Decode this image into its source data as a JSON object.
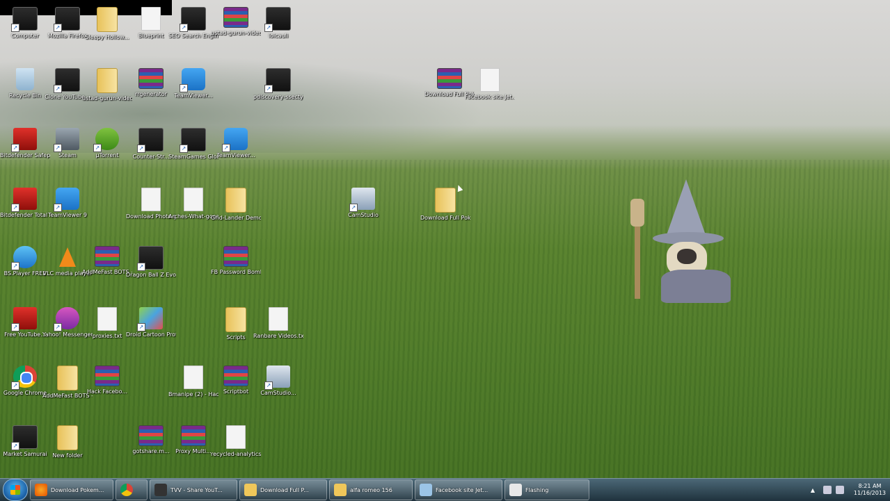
{
  "desktop_icons": [
    {
      "label": "Computer",
      "type": "app"
    },
    {
      "label": "Mozilla Firefox",
      "type": "app"
    },
    {
      "label": "Sleepy Hollow...",
      "type": "folder"
    },
    {
      "label": "Blueprint",
      "type": "doc"
    },
    {
      "label": "SEO Search Engine R...",
      "type": "app"
    },
    {
      "label": "ustad-gurun-video-sad...",
      "type": "rar"
    },
    {
      "label": "loicauli",
      "type": "app"
    },
    {
      "label": "Recycle Bin",
      "type": "bin"
    },
    {
      "label": "Clone YouTube...",
      "type": "app"
    },
    {
      "label": "ustad-gurun-video-sad...",
      "type": "folder"
    },
    {
      "label": "rrgenerator",
      "type": "rar"
    },
    {
      "label": "TeamViewer...",
      "type": "tv"
    },
    {
      "label": "pdlscovery-ssecty5.exe",
      "type": "app"
    },
    {
      "label": "Bitdefender Safepay",
      "type": "red"
    },
    {
      "label": "Steam",
      "type": "key"
    },
    {
      "label": "µTorrent",
      "type": "green"
    },
    {
      "label": "Counter-Str...",
      "type": "app"
    },
    {
      "label": "SteamGames Global Pla...",
      "type": "app"
    },
    {
      "label": "TeamViewer...",
      "type": "tv"
    },
    {
      "label": "Bitdefender Total Security",
      "type": "red"
    },
    {
      "label": "TeamViewer 9",
      "type": "tv"
    },
    {
      "label": "Download Photo-get...",
      "type": "doc"
    },
    {
      "label": "Arches-What-goes-across...",
      "type": "doc"
    },
    {
      "label": "Grid-Lander Demo",
      "type": "folder"
    },
    {
      "label": "BS.Player FREE",
      "type": "blue"
    },
    {
      "label": "VLC media player",
      "type": "vlc"
    },
    {
      "label": "AddMeFast BOTS - Sep...",
      "type": "rar"
    },
    {
      "label": "Dragon Ball Z Evo",
      "type": "app"
    },
    {
      "label": "FB Password Bomb.zip",
      "type": "rar"
    },
    {
      "label": "Free YouTube...",
      "type": "red"
    },
    {
      "label": "Yahoo! Messenger",
      "type": "pink"
    },
    {
      "label": "proxies.txt",
      "type": "doc"
    },
    {
      "label": "Droid Cartoon Professional",
      "type": "multi"
    },
    {
      "label": "Scripts",
      "type": "folder"
    },
    {
      "label": "Ranbare Videos.txt",
      "type": "doc"
    },
    {
      "label": "Google Chrome",
      "type": "chrome"
    },
    {
      "label": "AddMeFast BOTS - Sep...",
      "type": "folder"
    },
    {
      "label": "Hack Facebo...",
      "type": "rar"
    },
    {
      "label": "Bmanipe (2) - Hacking.txt",
      "type": "doc"
    },
    {
      "label": "Scriptbot",
      "type": "rar"
    },
    {
      "label": "CamStudio...",
      "type": "cam"
    },
    {
      "label": "Market Samurai",
      "type": "app"
    },
    {
      "label": "New folder",
      "type": "folder"
    },
    {
      "label": "gotshare.m...",
      "type": "rar"
    },
    {
      "label": "Proxy Multi...",
      "type": "rar"
    },
    {
      "label": "recycled-analytics.csv",
      "type": "doc"
    },
    {
      "label": "CamStudio",
      "type": "cam"
    },
    {
      "label": "Download Full Pok...",
      "type": "folder"
    },
    {
      "label": "Download Full Pokemon Jetty.BW.zip",
      "type": "rar"
    },
    {
      "label": "Facebook site Jet...zip",
      "type": "doc"
    }
  ],
  "taskbar": {
    "start_label": "Start",
    "items": [
      {
        "label": "Download Pokem..."
      },
      {
        "label": ""
      },
      {
        "label": "TVV - Share YouT..."
      },
      {
        "label": "Download Full P..."
      },
      {
        "label": "alfa romeo 156"
      },
      {
        "label": "Facebook site Jet..."
      },
      {
        "label": "Flashing"
      }
    ],
    "clock": {
      "time": "8:21 AM",
      "date": "11/16/2013"
    }
  }
}
